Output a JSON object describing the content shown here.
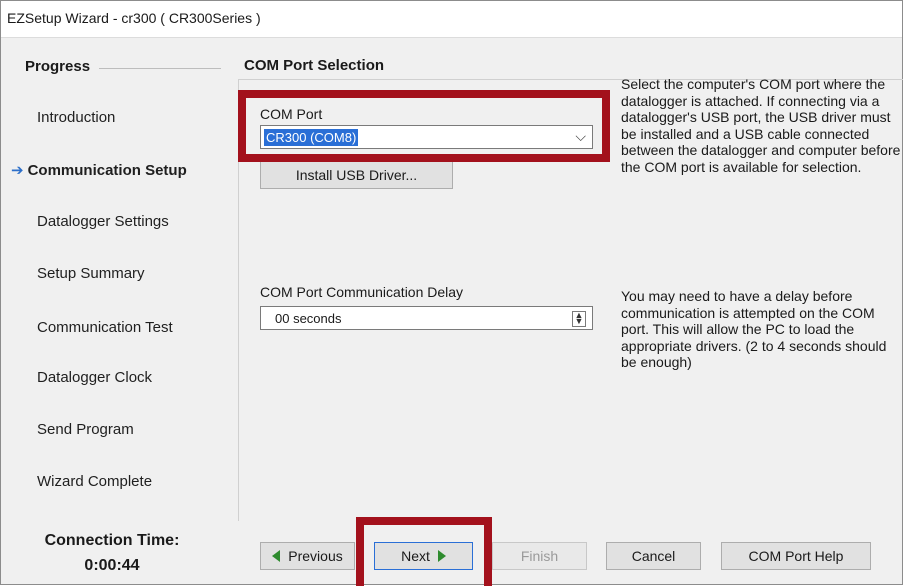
{
  "window": {
    "title": "EZSetup Wizard - cr300 ( CR300Series )"
  },
  "sidebar": {
    "title": "Progress",
    "items": [
      {
        "label": "Introduction",
        "active": false
      },
      {
        "label": "Communication Setup",
        "active": true
      },
      {
        "label": "Datalogger Settings",
        "active": false
      },
      {
        "label": "Setup Summary",
        "active": false
      },
      {
        "label": "Communication Test",
        "active": false
      },
      {
        "label": "Datalogger Clock",
        "active": false
      },
      {
        "label": "Send Program",
        "active": false
      },
      {
        "label": "Wizard Complete",
        "active": false
      }
    ],
    "connection_time_label": "Connection Time:",
    "connection_time_value": "0:00:44",
    "active_arrow": "➔"
  },
  "main": {
    "section_title": "COM Port Selection",
    "com_port": {
      "label": "COM Port",
      "value": "CR300 (COM8)",
      "chevron": "⌵"
    },
    "install_usb_button": "Install USB Driver...",
    "help_com_port": "Select the computer's COM port where the datalogger is attached.  If connecting via a datalogger's USB port, the USB driver must be installed and a USB cable connected between the datalogger and computer before the COM port is available for selection.",
    "delay": {
      "label": "COM Port Communication Delay",
      "value": "00 seconds",
      "spin_glyph": "▲\n▼"
    },
    "help_delay": "You may need to have a delay before communication is attempted on the COM port.  This will allow the PC to load the appropriate drivers. (2 to 4 seconds should be enough)"
  },
  "footer": {
    "previous": "Previous",
    "next": "Next",
    "finish": "Finish",
    "cancel": "Cancel",
    "help": "COM Port Help"
  },
  "colors": {
    "highlight": "#a3111c",
    "selection": "#2a6fd6",
    "arrow": "#2e8b2e"
  }
}
